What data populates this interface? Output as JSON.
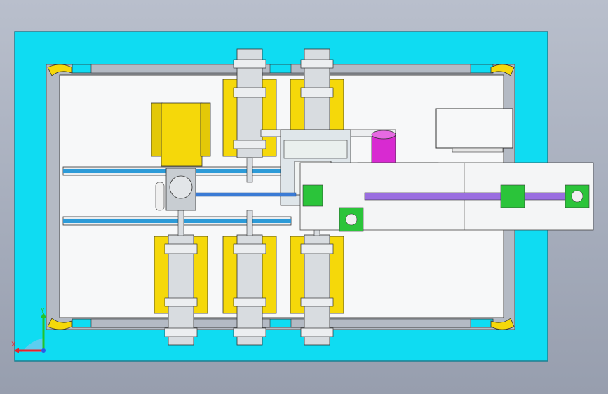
{
  "viewport": {
    "background_top": "#b9bfcc",
    "background_bottom": "#979eae"
  },
  "colors": {
    "base_frame": "#0fdcf2",
    "base_edge": "#1d7f91",
    "rail_inner": "#b4bac4",
    "plate": "#f7f8f9",
    "cylinder_mount": "#f5d80a",
    "cylinder_body": "#d8dce0",
    "linear_rail": "#2d9bd8",
    "shaft": "#3a7bd5",
    "motor_cap": "#d82ad1",
    "conveyor_link": "#9a6ee0",
    "sensor_mount": "#2bc43a",
    "clamp_fitting": "#e0a81c"
  },
  "cylinders_top": [
    {
      "label": "cylinder-top-1"
    },
    {
      "label": "cylinder-top-2"
    }
  ],
  "cylinders_bottom": [
    {
      "label": "cylinder-bottom-1"
    },
    {
      "label": "cylinder-bottom-2"
    },
    {
      "label": "cylinder-bottom-3"
    }
  ],
  "triad": {
    "x_label": "X",
    "y_label": "Y",
    "x_color": "#e8222a",
    "y_color": "#22c32a",
    "z_color": "#2a5be8"
  }
}
